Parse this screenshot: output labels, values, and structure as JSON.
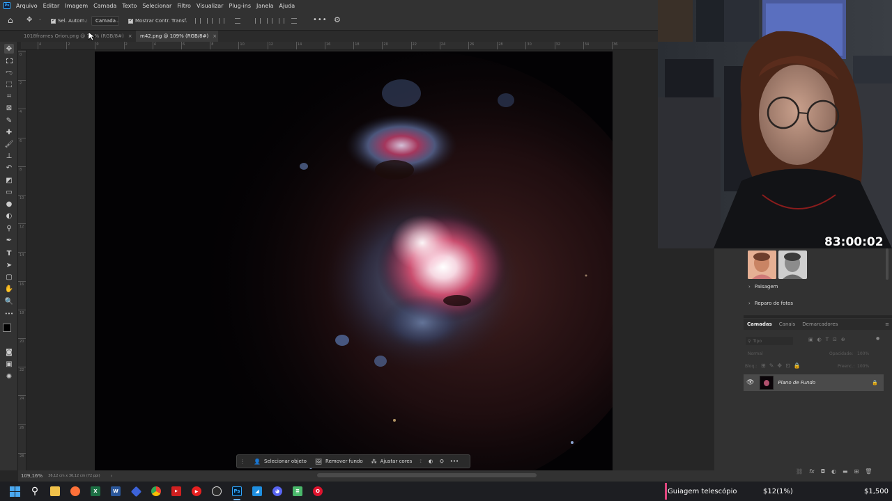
{
  "app": {
    "logo_text": "Ps"
  },
  "menu": [
    "Arquivo",
    "Editar",
    "Imagem",
    "Camada",
    "Texto",
    "Selecionar",
    "Filtro",
    "Visualizar",
    "Plug-ins",
    "Janela",
    "Ajuda"
  ],
  "options": {
    "auto_select_label": "Sel. Autom.:",
    "auto_select_value": "Camada",
    "show_transform_label": "Mostrar Contr. Transf."
  },
  "tabs": [
    {
      "label": "1018frames Orion.png @ 7...% (RGB/8#)",
      "close": "×"
    },
    {
      "label": "m42.png @ 109% (RGB/8#)",
      "close": "×"
    }
  ],
  "ruler_top": [
    "4",
    "2",
    "0",
    "2",
    "4",
    "6",
    "8",
    "10",
    "12",
    "14",
    "16",
    "18",
    "20",
    "22",
    "24",
    "26",
    "28",
    "30",
    "32",
    "34",
    "36"
  ],
  "ruler_left": [
    "0",
    "2",
    "4",
    "6",
    "8",
    "10",
    "12",
    "14",
    "16",
    "18",
    "20",
    "22",
    "24",
    "26",
    "28"
  ],
  "status": {
    "zoom": "109,16%",
    "doc_size": "36,12 cm x 36,12 cm (72 ppi)",
    "arrow": "›"
  },
  "context_bar": {
    "select_object": "Selecionar objeto",
    "remove_bg": "Remover fundo",
    "adjust_colors": "Ajustar cores",
    "more": "•••"
  },
  "stream": {
    "timer": "83:00:02"
  },
  "neural_filters": {
    "categories": [
      "Paisagem",
      "Reparo de fotos"
    ]
  },
  "layers_panel": {
    "tabs": [
      "Camadas",
      "Canais",
      "Demarcadores"
    ],
    "search_placeholder": "Tipo",
    "blend_mode": "Normal",
    "opacity_label": "Opacidade:",
    "opacity_value": "100%",
    "lock_label": "Bloq.:",
    "fill_label": "Preenc.:",
    "fill_value": "100%",
    "layer_name": "Plano de Fundo"
  },
  "ticker": {
    "item": "Guiagem telescópio",
    "amount": "$12(1%)",
    "total": "$1,500"
  },
  "taskbar": {
    "apps": [
      "windows-start",
      "search",
      "file-explorer",
      "firefox",
      "excel",
      "word",
      "vpn",
      "chrome",
      "streaming-app",
      "media-player",
      "obs",
      "photoshop",
      "paint-app",
      "discord",
      "notepad",
      "opera"
    ]
  }
}
